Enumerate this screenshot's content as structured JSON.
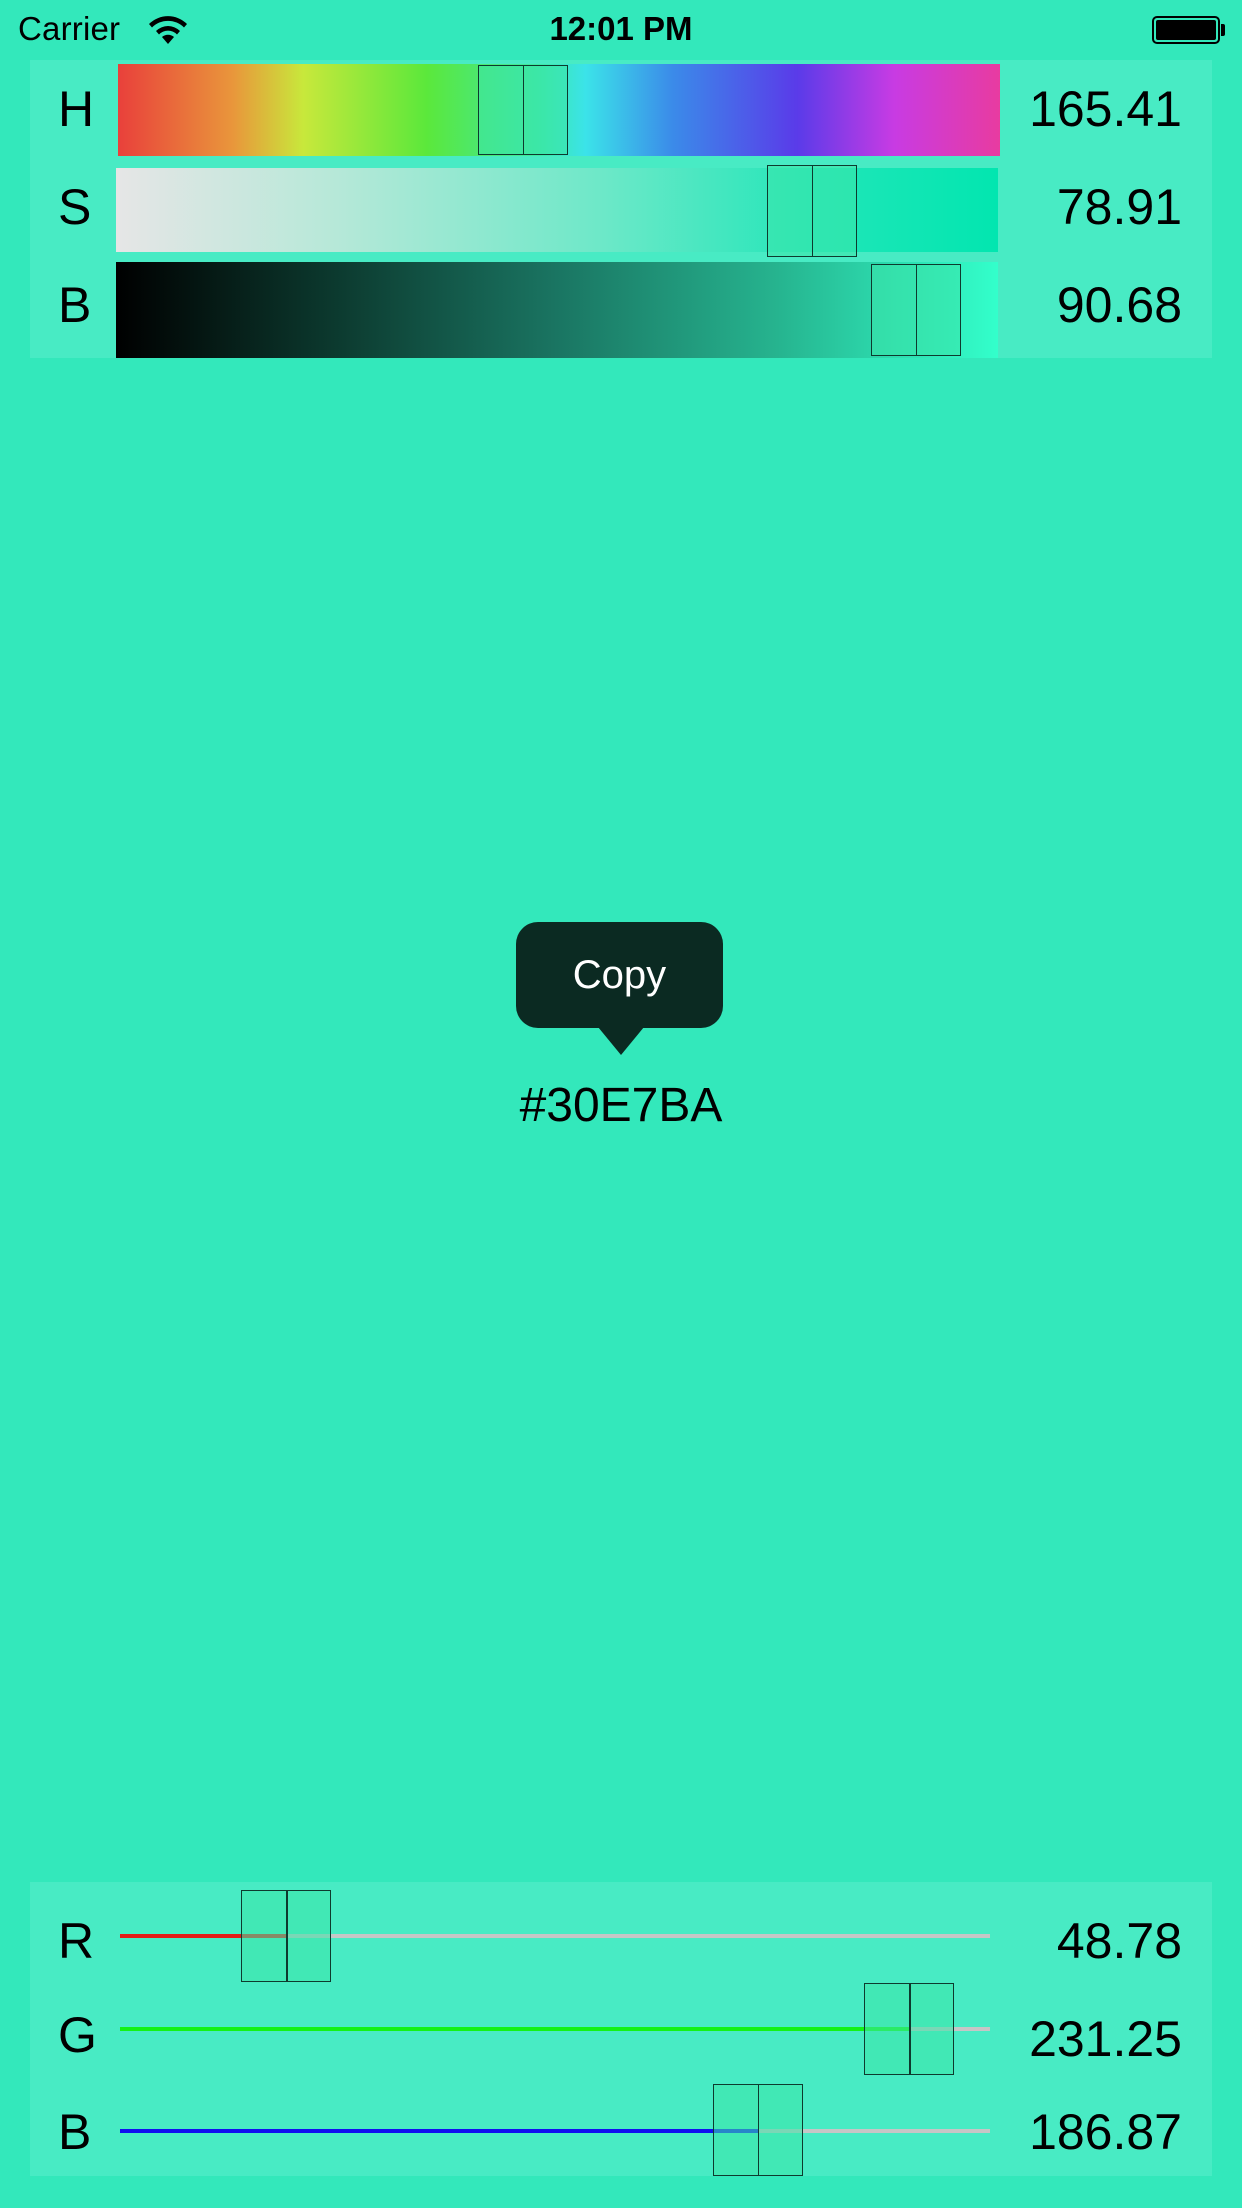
{
  "status_bar": {
    "carrier": "Carrier",
    "time": "12:01 PM"
  },
  "hsb": {
    "hue": {
      "label": "H",
      "value": "165.41",
      "fraction": 0.459
    },
    "saturation": {
      "label": "S",
      "value": "78.91",
      "fraction": 0.7891
    },
    "brightness": {
      "label": "B",
      "value": "90.68",
      "fraction": 0.9068
    }
  },
  "color": {
    "hex": "#30E7BA",
    "background": "#33E8BB"
  },
  "copy_button": {
    "label": "Copy"
  },
  "rgb": {
    "red": {
      "label": "R",
      "value": "48.78",
      "fraction": 0.1913,
      "color": "#E41B17"
    },
    "green": {
      "label": "G",
      "value": "231.25",
      "fraction": 0.9069,
      "color": "#14F214"
    },
    "blue": {
      "label": "B",
      "value": "186.87",
      "fraction": 0.7328,
      "color": "#1010F0"
    }
  }
}
